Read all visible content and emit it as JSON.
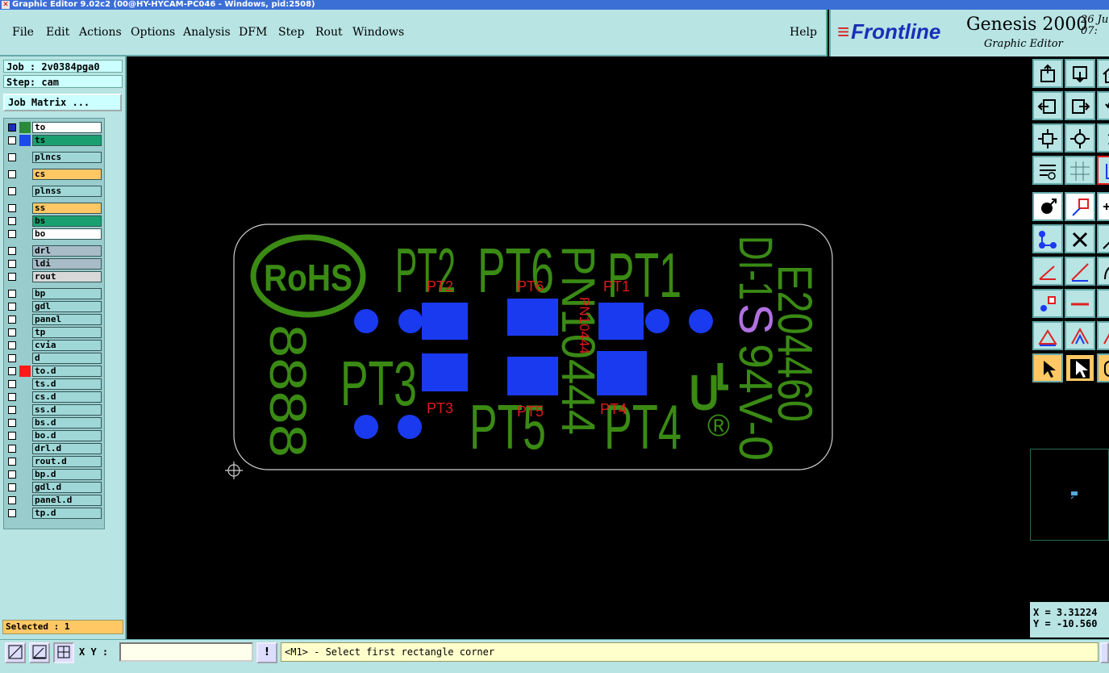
{
  "window": {
    "title": "Graphic Editor 9.02c2 (00@HY-HYCAM-PC046 - Windows, pid:2508)"
  },
  "menu": {
    "items": [
      "File",
      "Edit",
      "Actions",
      "Options",
      "Analysis",
      "DFM",
      "Step",
      "Rout",
      "Windows"
    ],
    "help": "Help"
  },
  "brand": {
    "logo": "Frontline",
    "app": "Genesis 2000",
    "subtitle": "Graphic Editor",
    "date_day": "26 Ju",
    "time": "07:"
  },
  "job": {
    "job_label": "Job : 2v0384pga0",
    "step_label": "Step: cam",
    "matrix_button": "Job Matrix ..."
  },
  "layers": [
    {
      "name": "to",
      "color": "#ffffff",
      "swatch": "#2a8a3a",
      "checked": true
    },
    {
      "name": "ts",
      "color": "#1aa070",
      "swatch": "#1a4ae8",
      "checked": false
    },
    {
      "name": "plncs",
      "color": "#9fd7d7",
      "checked": false
    },
    {
      "name": "cs",
      "color": "#ffc864",
      "checked": false
    },
    {
      "name": "plnss",
      "color": "#9fd7d7",
      "checked": false
    },
    {
      "name": "ss",
      "color": "#ffc864",
      "checked": false
    },
    {
      "name": "bs",
      "color": "#1aa070",
      "checked": false
    },
    {
      "name": "bo",
      "color": "#ffffff",
      "checked": false
    },
    {
      "name": "drl",
      "color": "#a8bcc8",
      "checked": false
    },
    {
      "name": "ldi",
      "color": "#a8bcc8",
      "checked": false
    },
    {
      "name": "rout",
      "color": "#d8d8d8",
      "checked": false
    },
    {
      "name": "bp",
      "color": "#9fd7d7",
      "checked": false
    },
    {
      "name": "gdl",
      "color": "#9fd7d7",
      "checked": false
    },
    {
      "name": "panel",
      "color": "#9fd7d7",
      "checked": false
    },
    {
      "name": "tp",
      "color": "#9fd7d7",
      "checked": false
    },
    {
      "name": "cvia",
      "color": "#9fd7d7",
      "checked": false
    },
    {
      "name": "d",
      "color": "#9fd7d7",
      "checked": false
    },
    {
      "name": "to.d",
      "color": "#9fd7d7",
      "swatch": "#ff1a1a",
      "checked": false
    },
    {
      "name": "ts.d",
      "color": "#9fd7d7",
      "checked": false
    },
    {
      "name": "cs.d",
      "color": "#9fd7d7",
      "checked": false
    },
    {
      "name": "ss.d",
      "color": "#9fd7d7",
      "checked": false
    },
    {
      "name": "bs.d",
      "color": "#9fd7d7",
      "checked": false
    },
    {
      "name": "bo.d",
      "color": "#9fd7d7",
      "checked": false
    },
    {
      "name": "drl.d",
      "color": "#9fd7d7",
      "checked": false
    },
    {
      "name": "rout.d",
      "color": "#9fd7d7",
      "checked": false
    },
    {
      "name": "bp.d",
      "color": "#9fd7d7",
      "checked": false
    },
    {
      "name": "gdl.d",
      "color": "#9fd7d7",
      "checked": false
    },
    {
      "name": "panel.d",
      "color": "#9fd7d7",
      "checked": false
    },
    {
      "name": "tp.d",
      "color": "#9fd7d7",
      "checked": false
    }
  ],
  "selected": "Selected : 1",
  "board": {
    "green_labels": [
      "PT2",
      "PT6",
      "PT1",
      "PT3",
      "PT5",
      "PT4",
      "RoHS",
      "8888",
      "E204460",
      "DI-1",
      "S",
      "94V-0",
      "PN10444",
      "®"
    ],
    "red_labels": [
      "PT2",
      "PT6",
      "PT1",
      "PT3",
      "PT5",
      "PT4",
      "PN10444"
    ]
  },
  "coords": {
    "x": "X = 3.31224",
    "y": "Y = -10.560"
  },
  "bottom": {
    "xy_label": "X Y :",
    "xy_value": "",
    "message": "<M1> - Select first rectangle corner",
    "alert_button": "!"
  },
  "colors": {
    "panel_bg": "#b8e4e4",
    "silk": "#3a8a14",
    "pad": "#1a3af0",
    "text_red": "#e01a1a"
  }
}
